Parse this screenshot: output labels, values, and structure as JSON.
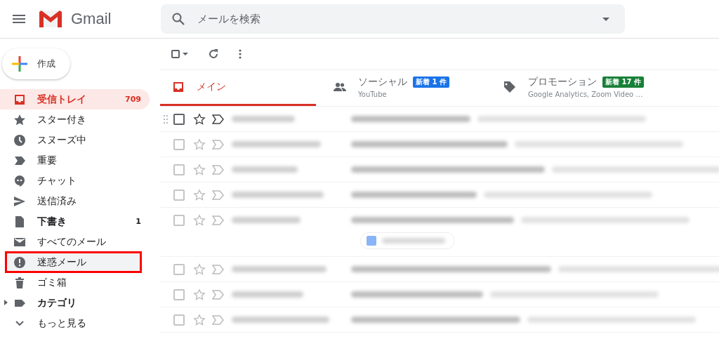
{
  "header": {
    "app_name": "Gmail",
    "search": {
      "placeholder": "メールを検索"
    }
  },
  "compose": {
    "label": "作成"
  },
  "toolbar": {
    "select_all_checked": false
  },
  "sidebar": {
    "items": [
      {
        "kind": "inbox",
        "label": "受信トレイ",
        "count": "709",
        "selected": true,
        "bold": true,
        "hovered": false,
        "highlighted": false
      },
      {
        "kind": "star",
        "label": "スター付き",
        "selected": false,
        "bold": false,
        "hovered": false,
        "highlighted": false
      },
      {
        "kind": "clock",
        "label": "スヌーズ中",
        "selected": false,
        "bold": false,
        "hovered": false,
        "highlighted": false
      },
      {
        "kind": "important",
        "label": "重要",
        "selected": false,
        "bold": false,
        "hovered": false,
        "highlighted": false
      },
      {
        "kind": "chat",
        "label": "チャット",
        "selected": false,
        "bold": false,
        "hovered": false,
        "highlighted": false
      },
      {
        "kind": "send",
        "label": "送信済み",
        "selected": false,
        "bold": false,
        "hovered": false,
        "highlighted": false
      },
      {
        "kind": "draft",
        "label": "下書き",
        "count": "1",
        "selected": false,
        "bold": true,
        "hovered": false,
        "highlighted": false
      },
      {
        "kind": "mail",
        "label": "すべてのメール",
        "selected": false,
        "bold": false,
        "hovered": false,
        "highlighted": false
      },
      {
        "kind": "spam",
        "label": "迷惑メール",
        "selected": false,
        "bold": false,
        "hovered": true,
        "highlighted": true
      },
      {
        "kind": "trash",
        "label": "ゴミ箱",
        "selected": false,
        "bold": false,
        "hovered": false,
        "highlighted": false
      },
      {
        "kind": "label",
        "label": "カテゴリ",
        "selected": false,
        "bold": true,
        "hovered": false,
        "highlighted": false,
        "expandable": true
      },
      {
        "kind": "more",
        "label": "もっと見る",
        "selected": false,
        "bold": false,
        "hovered": false,
        "highlighted": false
      }
    ]
  },
  "tabs": [
    {
      "kind": "inbox",
      "label": "メイン",
      "selected": true
    },
    {
      "kind": "people",
      "label": "ソーシャル",
      "badge": "新着 1 件",
      "color": "#1a73e8",
      "subtitle": "YouTube",
      "selected": false
    },
    {
      "kind": "tag",
      "label": "プロモーション",
      "badge": "新着 17 件",
      "color": "#188038",
      "subtitle": "Google Analytics, Zoom Video …",
      "selected": false
    }
  ],
  "email_rows": [
    {
      "hovered": true,
      "attachment": false
    },
    {
      "hovered": false,
      "attachment": false
    },
    {
      "hovered": false,
      "attachment": false
    },
    {
      "hovered": false,
      "attachment": false
    },
    {
      "hovered": false,
      "attachment": true
    },
    {
      "hovered": false,
      "attachment": false
    },
    {
      "hovered": false,
      "attachment": false
    },
    {
      "hovered": false,
      "attachment": false
    }
  ]
}
